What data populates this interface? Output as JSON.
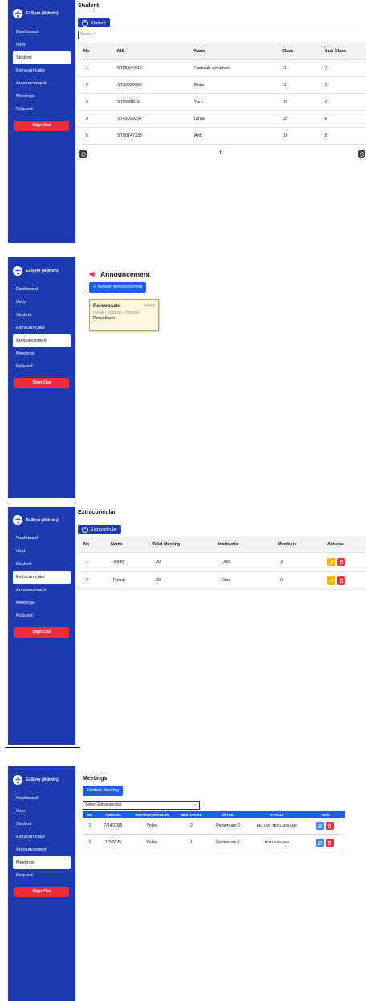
{
  "sidebar": {
    "brand": "EsSym (Admin)",
    "items": [
      "Dashboard",
      "User",
      "Student",
      "Extracurricular",
      "Announcement",
      "Meetings",
      "Request"
    ],
    "signout": "Sign Out"
  },
  "student": {
    "title": "Student",
    "add_button": "Student",
    "search_placeholder": "Search...",
    "columns": [
      "No",
      "NIS",
      "Name",
      "Class",
      "Sub Class"
    ],
    "rows": [
      [
        "1",
        "ST85344012",
        "Hamzah Jonathan",
        "11",
        "A"
      ],
      [
        "2",
        "ST35354308",
        "Robin",
        "11",
        "C"
      ],
      [
        "3",
        "ST5592819",
        "Yum",
        "10",
        "C"
      ],
      [
        "4",
        "ST45029232",
        "Dinas",
        "12",
        "E"
      ],
      [
        "5",
        "ST90147333",
        "Ardi",
        "10",
        "B"
      ]
    ],
    "page": "1"
  },
  "announcement": {
    "title": "Announcement",
    "add_button": "+ Tambah Announcement",
    "card": {
      "title": "Percobaan",
      "tag": "Umum",
      "period": "Periode: 7/14/2025 - 7/28/2025",
      "body": "Percobaan"
    }
  },
  "extracurricular": {
    "title": "Extracuricular",
    "add_button": "Extracuricular",
    "columns": [
      "No",
      "Name",
      "Total Meeting",
      "Instructor",
      "Members",
      "Actions"
    ],
    "rows": [
      [
        "1",
        "Volley",
        "20",
        "Dani",
        "3"
      ],
      [
        "2",
        "Futsal",
        "20",
        "Dani",
        "0"
      ]
    ]
  },
  "meetings": {
    "title": "Meetings",
    "add_button": "Tambah Meeting",
    "select_placeholder": "Select Extracuricular",
    "columns": [
      "NO",
      "TANGGAL",
      "EKSTRAKURIKULER",
      "MEETING KE",
      "DETAIL",
      "STATUS",
      "AKSI"
    ],
    "rows": [
      [
        "1",
        "7/14/2025",
        "Volley",
        "2",
        "Pertemuan 2",
        "BELUM_TERLAKSANA"
      ],
      [
        "2",
        "7/7/2025",
        "Volley",
        "1",
        "Pertemuan 1",
        "TERLAKSANA"
      ]
    ]
  },
  "colors": {
    "sidebar": "#1d3aaf",
    "signout": "#ef2d3a",
    "edit": "#f5b400",
    "delete": "#ef2d3a",
    "meeting_header": "#1d5ee8"
  }
}
